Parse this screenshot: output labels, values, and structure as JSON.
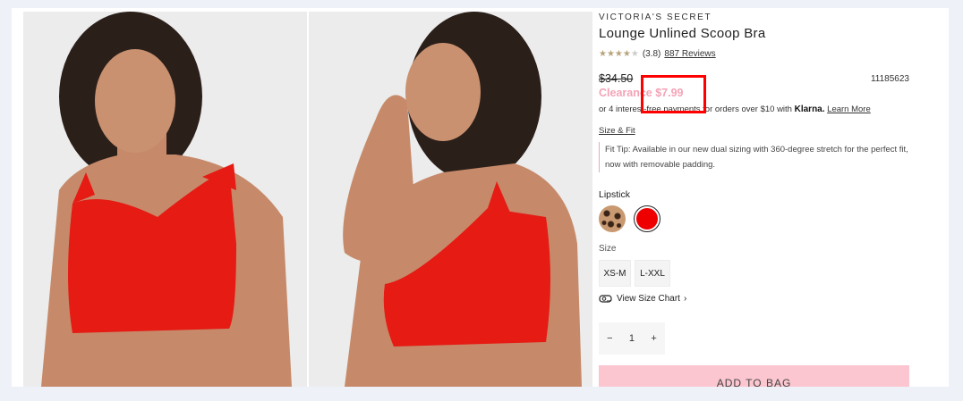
{
  "product": {
    "brand": "VICTORIA'S SECRET",
    "title": "Lounge Unlined Scoop Bra",
    "rating_text": "(3.8)",
    "rating_value": 3.8,
    "reviews": "887 Reviews",
    "original_price": "$34.50",
    "sku": "11185623",
    "clearance_price": "Clearance $7.99",
    "klarna_prefix": "or 4 interest-free payments for orders over $10 with",
    "klarna_brand": "Klarna.",
    "klarna_link": "Learn More",
    "size_fit_link": "Size & Fit",
    "fit_tip": "Fit Tip: Available in our new dual sizing with 360-degree stretch for the perfect fit, now with removable padding.",
    "color_label": "Lipstick",
    "size_label": "Size",
    "sizes": [
      "XS-M",
      "L-XXL"
    ],
    "size_chart": "View Size Chart",
    "quantity": "1",
    "add_to_bag": "ADD TO BAG"
  },
  "colors": {
    "accent_pink": "#f4a3b7",
    "add_bag_bg": "#fbc6cf",
    "swatch_red": "#ee0000",
    "highlight": "#ff0000"
  }
}
